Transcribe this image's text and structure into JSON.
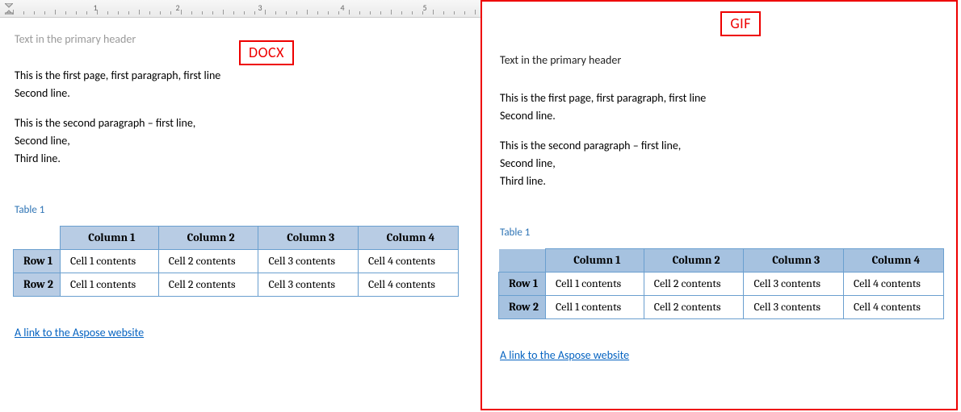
{
  "tags": {
    "docx": "DOCX",
    "gif": "GIF"
  },
  "ruler": {
    "numbers": [
      "1",
      "2",
      "3",
      "4",
      "5"
    ]
  },
  "docx": {
    "header": "Text in the primary header",
    "p1l1": "This is the first page, first paragraph, first line",
    "p1l2": "Second line.",
    "p2l1": "This is the second paragraph – first line,",
    "p2l2": "Second line,",
    "p2l3": "Third line.",
    "caption": "Table 1",
    "table": {
      "cols": [
        "Column 1",
        "Column 2",
        "Column 3",
        "Column 4"
      ],
      "rows": [
        {
          "head": "Row 1",
          "cells": [
            "Cell 1 contents",
            "Cell 2 contents",
            "Cell 3 contents",
            "Cell 4 contents"
          ]
        },
        {
          "head": "Row 2",
          "cells": [
            "Cell 1 contents",
            "Cell 2 contents",
            "Cell 3 contents",
            "Cell 4 contents"
          ]
        }
      ]
    },
    "link": "A link to the Aspose website"
  },
  "gif": {
    "header": "Text in the primary header",
    "p1l1": "This is the first page, first paragraph, first line",
    "p1l2": "Second line.",
    "p2l1": "This is the second paragraph – first line,",
    "p2l2": "Second line,",
    "p2l3": "Third line.",
    "caption": "Table 1",
    "table": {
      "cols": [
        "Column 1",
        "Column 2",
        "Column 3",
        "Column 4"
      ],
      "rows": [
        {
          "head": "Row 1",
          "cells": [
            "Cell 1 contents",
            "Cell 2 contents",
            "Cell 3 contents",
            "Cell 4 contents"
          ]
        },
        {
          "head": "Row 2",
          "cells": [
            "Cell 1 contents",
            "Cell 2 contents",
            "Cell 3 contents",
            "Cell 4 contents"
          ]
        }
      ]
    },
    "link": "A link to the Aspose website"
  }
}
